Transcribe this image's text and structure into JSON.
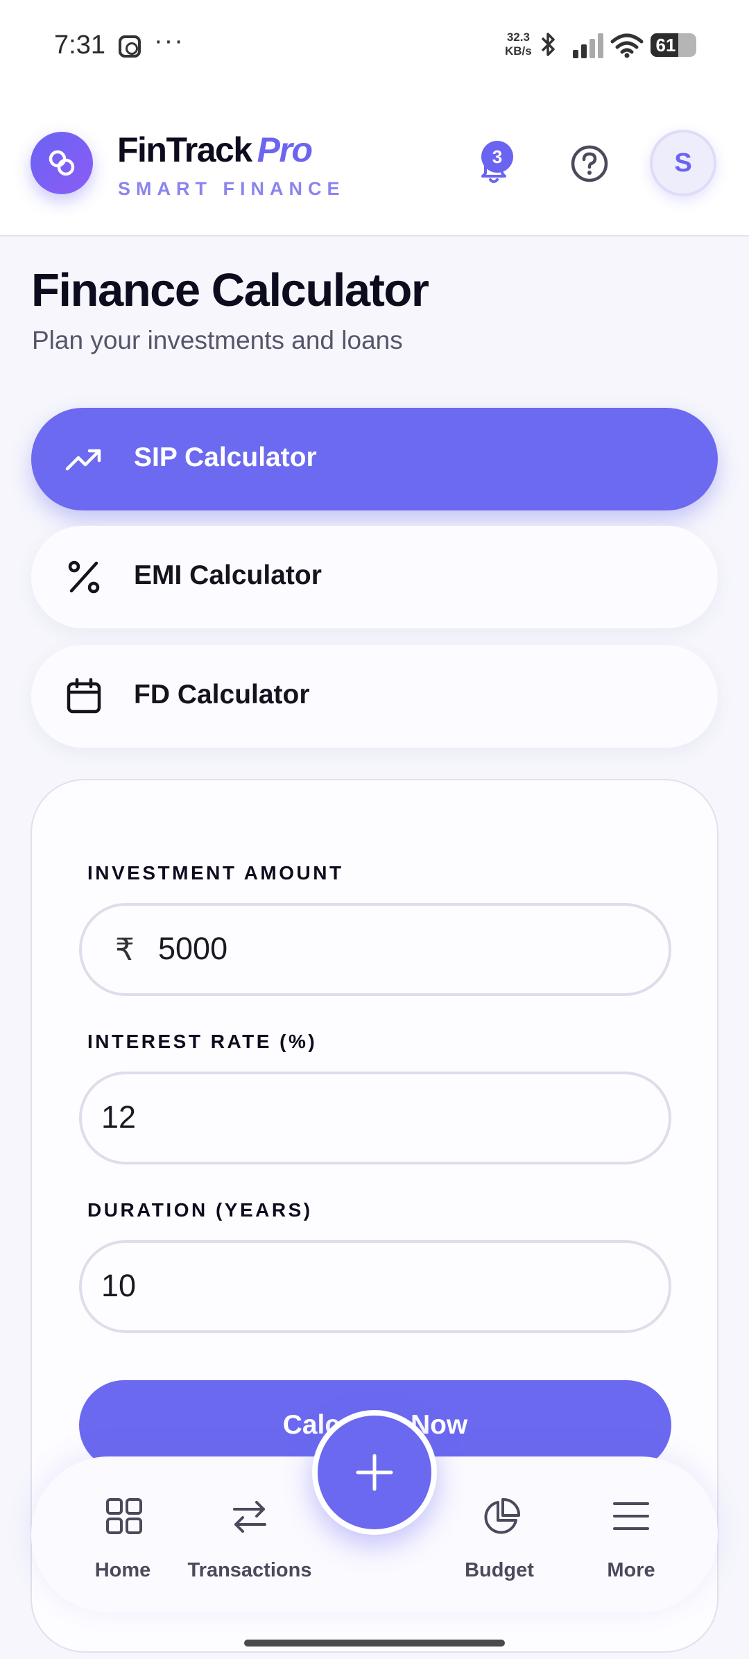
{
  "status_bar": {
    "time": "7:31",
    "more": "···",
    "speed_value": "32.3",
    "speed_unit": "KB/s",
    "battery": "61",
    "battery_level_percent": 61
  },
  "header": {
    "brand_name": "FinTrack",
    "brand_suffix": "Pro",
    "tagline": "SMART FINANCE",
    "notification_count": "3",
    "avatar_initial": "S"
  },
  "page": {
    "title": "Finance Calculator",
    "subtitle": "Plan your investments and loans"
  },
  "tabs": [
    {
      "label": "SIP Calculator",
      "icon": "trending-up-icon",
      "active": true
    },
    {
      "label": "EMI Calculator",
      "icon": "percent-icon",
      "active": false
    },
    {
      "label": "FD Calculator",
      "icon": "calendar-icon",
      "active": false
    }
  ],
  "form": {
    "investment_amount": {
      "label": "INVESTMENT AMOUNT",
      "prefix": "₹",
      "value": "5000"
    },
    "interest_rate": {
      "label": "INTEREST RATE (%)",
      "value": "12"
    },
    "duration": {
      "label": "DURATION (YEARS)",
      "value": "10"
    },
    "submit_label": "Calculate Now"
  },
  "bottom_nav": {
    "items": [
      {
        "label": "Home",
        "icon": "grid-icon"
      },
      {
        "label": "Transactions",
        "icon": "swap-icon"
      },
      {
        "label": "Budget",
        "icon": "pie-chart-icon"
      },
      {
        "label": "More",
        "icon": "menu-icon"
      }
    ],
    "fab_icon": "plus-icon"
  },
  "colors": {
    "accent": "#6B6AF0",
    "background": "#F6F6FC",
    "text_primary": "#0C0C1E",
    "text_secondary": "#55556A"
  }
}
